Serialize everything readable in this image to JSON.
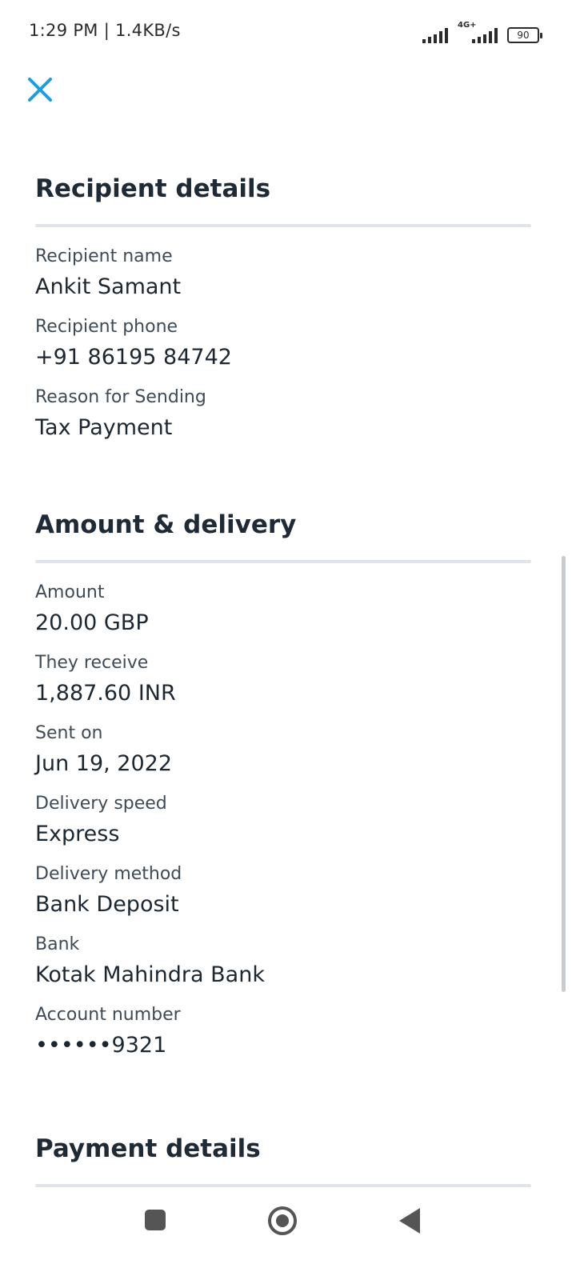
{
  "status_bar": {
    "text": "1:29 PM | 1.4KB/s",
    "network": "4G+",
    "battery": "90"
  },
  "icons": {
    "close": "close-icon",
    "nav_recent": "square-icon",
    "nav_home": "circle-icon",
    "nav_back": "triangle-back-icon"
  },
  "colors": {
    "accent": "#1a9ee0",
    "divider": "#dfe4ea"
  },
  "recipient": {
    "title": "Recipient details",
    "fields": [
      {
        "label": "Recipient name",
        "value": "Ankit Samant"
      },
      {
        "label": "Recipient phone",
        "value": "+91 86195 84742"
      },
      {
        "label": "Reason for Sending",
        "value": "Tax Payment"
      }
    ]
  },
  "amount": {
    "title": "Amount & delivery",
    "fields": [
      {
        "label": "Amount",
        "value": "20.00 GBP"
      },
      {
        "label": "They receive",
        "value": "1,887.60 INR"
      },
      {
        "label": "Sent on",
        "value": "Jun 19, 2022"
      },
      {
        "label": "Delivery speed",
        "value": "Express"
      },
      {
        "label": "Delivery method",
        "value": "Bank Deposit"
      },
      {
        "label": "Bank",
        "value": "Kotak Mahindra Bank"
      },
      {
        "label": "Account number",
        "value": "••••••9321"
      }
    ]
  },
  "payment": {
    "title": "Payment details"
  }
}
